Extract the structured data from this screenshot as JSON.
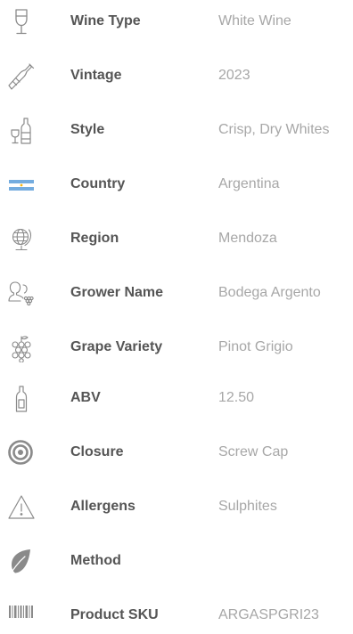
{
  "rows": [
    {
      "label": "Wine Type",
      "value": "White Wine",
      "icon": "wine-glass-icon"
    },
    {
      "label": "Vintage",
      "value": "2023",
      "icon": "bottle-icon"
    },
    {
      "label": "Style",
      "value": "Crisp, Dry Whites",
      "icon": "bottle-and-glass-icon"
    },
    {
      "label": "Country",
      "value": "Argentina",
      "icon": "argentina-flag-icon"
    },
    {
      "label": "Region",
      "value": "Mendoza",
      "icon": "globe-icon"
    },
    {
      "label": "Grower Name",
      "value": "Bodega Argento",
      "icon": "grower-icon"
    },
    {
      "label": "Grape Variety",
      "value": "Pinot Grigio",
      "icon": "grapes-icon"
    },
    {
      "label": "ABV",
      "value": "12.50",
      "icon": "abv-bottle-icon"
    },
    {
      "label": "Closure",
      "value": "Screw Cap",
      "icon": "closure-target-icon"
    },
    {
      "label": "Allergens",
      "value": "Sulphites",
      "icon": "warning-icon"
    },
    {
      "label": "Method",
      "value": "",
      "icon": "leaf-icon"
    },
    {
      "label": "Product SKU",
      "value": "ARGASPGRI23",
      "icon": "barcode-icon"
    }
  ],
  "colors": {
    "label": "#555555",
    "value": "#a7a7a7",
    "icon": "#8a8a8a",
    "flag_blue": "#74acdf",
    "flag_sun": "#f6b40e"
  }
}
